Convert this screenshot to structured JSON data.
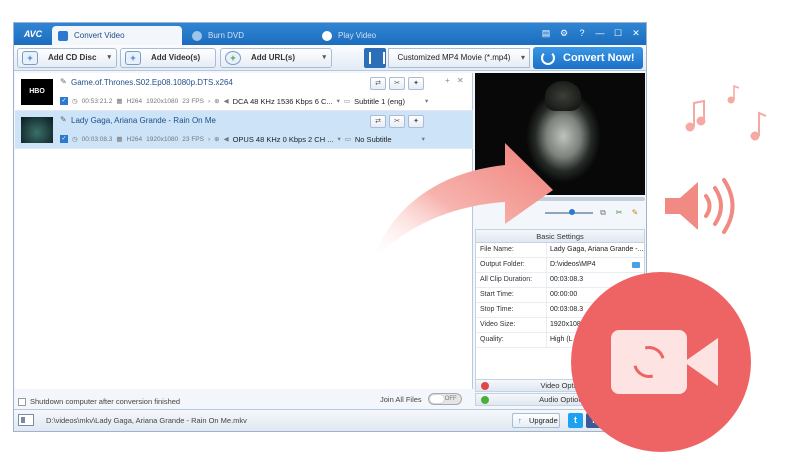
{
  "app": {
    "logo": "AVC",
    "tabs": [
      {
        "label": "Convert Video"
      },
      {
        "label": "Burn DVD"
      },
      {
        "label": "Play Video"
      }
    ],
    "window_buttons": [
      "▤",
      "⚙",
      "?",
      "—",
      "☐",
      "✕"
    ]
  },
  "toolbar": {
    "add_cd": "Add CD Disc",
    "add_video": "Add Video(s)",
    "add_url": "Add URL(s)",
    "format": "Customized MP4 Movie (*.mp4)",
    "convert": "Convert Now!"
  },
  "files": [
    {
      "name": "Game.of.Thrones.S02.Ep08.1080p.DTS.x264",
      "thumb_text": "HBO",
      "duration": "00:53:21.2",
      "codec": "H264",
      "resolution": "1920x1080",
      "fps": "23 FPS",
      "audio": "DCA 48 KHz 1536 Kbps 6 C...",
      "subtitle": "Subtitle 1 (eng)"
    },
    {
      "name": "Lady Gaga, Ariana Grande - Rain On Me",
      "thumb_text": "",
      "duration": "00:03:08.3",
      "codec": "H264",
      "resolution": "1920x1080",
      "fps": "23 FPS",
      "audio": "OPUS 48 KHz 0 Kbps 2 CH ...",
      "subtitle": "No Subtitle"
    }
  ],
  "bottom": {
    "shutdown": "Shutdown computer after conversion finished",
    "join": "Join All Files",
    "toggle": "OFF"
  },
  "settings": {
    "title": "Basic Settings",
    "rows": [
      {
        "key": "File Name:",
        "value": "Lady Gaga, Ariana Grande -..."
      },
      {
        "key": "Output Folder:",
        "value": "D:\\videos\\MP4"
      },
      {
        "key": "All Clip Duration:",
        "value": "00:03:08.3"
      },
      {
        "key": "Start Time:",
        "value": "00:00:00"
      },
      {
        "key": "Stop Time:",
        "value": "00:03:08.3"
      },
      {
        "key": "Video Size:",
        "value": "1920x108"
      },
      {
        "key": "Quality:",
        "value": "High (L"
      }
    ],
    "video_options": "Video Optio",
    "audio_options": "Audio Optior"
  },
  "statusbar": {
    "path": "D:\\videos\\mkv\\Lady Gaga, Ariana Grande - Rain On Me.mkv",
    "upgrade": "Upgrade"
  },
  "colors": {
    "brand_blue": "#2f86d4",
    "overlay_red": "#ee6464",
    "overlay_pink": "#f29a96"
  }
}
